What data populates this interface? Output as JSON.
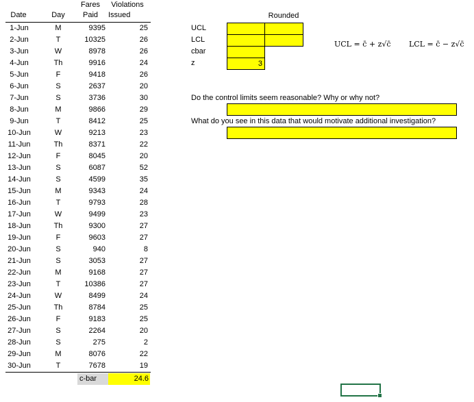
{
  "headers": {
    "date": "Date",
    "day": "Day",
    "fares_top": "Fares",
    "fares_bottom": "Paid",
    "viol_top": "Violations",
    "viol_bottom": "Issued",
    "rounded": "Rounded"
  },
  "rows": [
    {
      "date": "1-Jun",
      "day": "M",
      "fares": "9395",
      "violations": "25"
    },
    {
      "date": "2-Jun",
      "day": "T",
      "fares": "10325",
      "violations": "26"
    },
    {
      "date": "3-Jun",
      "day": "W",
      "fares": "8978",
      "violations": "26"
    },
    {
      "date": "4-Jun",
      "day": "Th",
      "fares": "9916",
      "violations": "24"
    },
    {
      "date": "5-Jun",
      "day": "F",
      "fares": "9418",
      "violations": "26"
    },
    {
      "date": "6-Jun",
      "day": "S",
      "fares": "2637",
      "violations": "20"
    },
    {
      "date": "7-Jun",
      "day": "S",
      "fares": "3736",
      "violations": "30"
    },
    {
      "date": "8-Jun",
      "day": "M",
      "fares": "9866",
      "violations": "29"
    },
    {
      "date": "9-Jun",
      "day": "T",
      "fares": "8412",
      "violations": "25"
    },
    {
      "date": "10-Jun",
      "day": "W",
      "fares": "9213",
      "violations": "23"
    },
    {
      "date": "11-Jun",
      "day": "Th",
      "fares": "8371",
      "violations": "22"
    },
    {
      "date": "12-Jun",
      "day": "F",
      "fares": "8045",
      "violations": "20"
    },
    {
      "date": "13-Jun",
      "day": "S",
      "fares": "6087",
      "violations": "52"
    },
    {
      "date": "14-Jun",
      "day": "S",
      "fares": "4599",
      "violations": "35"
    },
    {
      "date": "15-Jun",
      "day": "M",
      "fares": "9343",
      "violations": "24"
    },
    {
      "date": "16-Jun",
      "day": "T",
      "fares": "9793",
      "violations": "28"
    },
    {
      "date": "17-Jun",
      "day": "W",
      "fares": "9499",
      "violations": "23"
    },
    {
      "date": "18-Jun",
      "day": "Th",
      "fares": "9300",
      "violations": "27"
    },
    {
      "date": "19-Jun",
      "day": "F",
      "fares": "9603",
      "violations": "27"
    },
    {
      "date": "20-Jun",
      "day": "S",
      "fares": "940",
      "violations": "8"
    },
    {
      "date": "21-Jun",
      "day": "S",
      "fares": "3053",
      "violations": "27"
    },
    {
      "date": "22-Jun",
      "day": "M",
      "fares": "9168",
      "violations": "27"
    },
    {
      "date": "23-Jun",
      "day": "T",
      "fares": "10386",
      "violations": "27"
    },
    {
      "date": "24-Jun",
      "day": "W",
      "fares": "8499",
      "violations": "24"
    },
    {
      "date": "25-Jun",
      "day": "Th",
      "fares": "8784",
      "violations": "25"
    },
    {
      "date": "26-Jun",
      "day": "F",
      "fares": "9183",
      "violations": "25"
    },
    {
      "date": "27-Jun",
      "day": "S",
      "fares": "2264",
      "violations": "20"
    },
    {
      "date": "28-Jun",
      "day": "S",
      "fares": "275",
      "violations": "2"
    },
    {
      "date": "29-Jun",
      "day": "M",
      "fares": "8076",
      "violations": "22"
    },
    {
      "date": "30-Jun",
      "day": "T",
      "fares": "7678",
      "violations": "19"
    }
  ],
  "summary": {
    "label": "c-bar",
    "value": "24.6"
  },
  "params": [
    {
      "label": "UCL",
      "value": "",
      "rounded": ""
    },
    {
      "label": "LCL",
      "value": "",
      "rounded": ""
    },
    {
      "label": "cbar",
      "value": ""
    },
    {
      "label": "z",
      "value": "3"
    }
  ],
  "formulas": {
    "ucl": "UCL = c̄ + z√c̄",
    "lcl": "LCL = c̄ − z√c̄"
  },
  "questions": {
    "q1": "Do the control limits seem reasonable? Why or why not?",
    "q1_answer": "",
    "q2": "What do you see in this data that would motivate additional investigation?",
    "q2_answer": ""
  },
  "colors": {
    "highlight": "#ffff00",
    "summary_label_bg": "#d9d9d9",
    "selection": "#217346"
  }
}
